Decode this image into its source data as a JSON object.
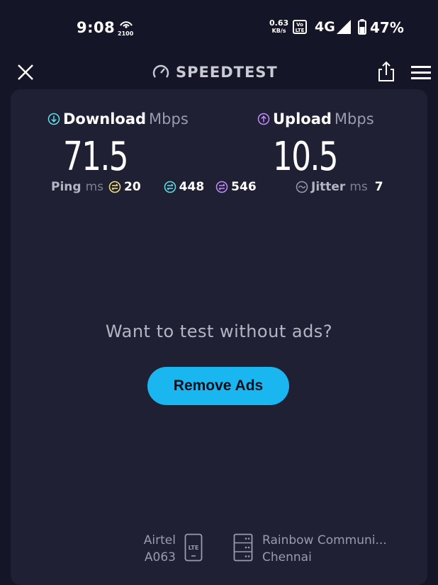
{
  "status_bar": {
    "time": "9:08",
    "hotspot_label": "2100",
    "speed_value": "0.63",
    "speed_unit": "KB/s",
    "volte_top": "Vo",
    "volte_bottom": "LTE",
    "network": "4G",
    "battery": "47%"
  },
  "header": {
    "brand": "SPEEDTEST"
  },
  "download": {
    "label": "Download",
    "unit": "Mbps",
    "value": "71.5"
  },
  "upload": {
    "label": "Upload",
    "unit": "Mbps",
    "value": "10.5"
  },
  "ping": {
    "label": "Ping",
    "unit": "ms",
    "idle": "20",
    "download": "448",
    "upload": "546"
  },
  "jitter": {
    "label": "Jitter",
    "unit": "ms",
    "value": "7"
  },
  "ad": {
    "message": "Want to test without ads?",
    "button": "Remove Ads"
  },
  "provider": {
    "name": "Airtel",
    "code": "A063",
    "tech": "LTE"
  },
  "server": {
    "name": "Rainbow Communi...",
    "city": "Chennai"
  },
  "colors": {
    "accent": "#1ab6f0",
    "download": "#5de0e6",
    "upload": "#c28cff",
    "idle": "#f5e27a"
  }
}
